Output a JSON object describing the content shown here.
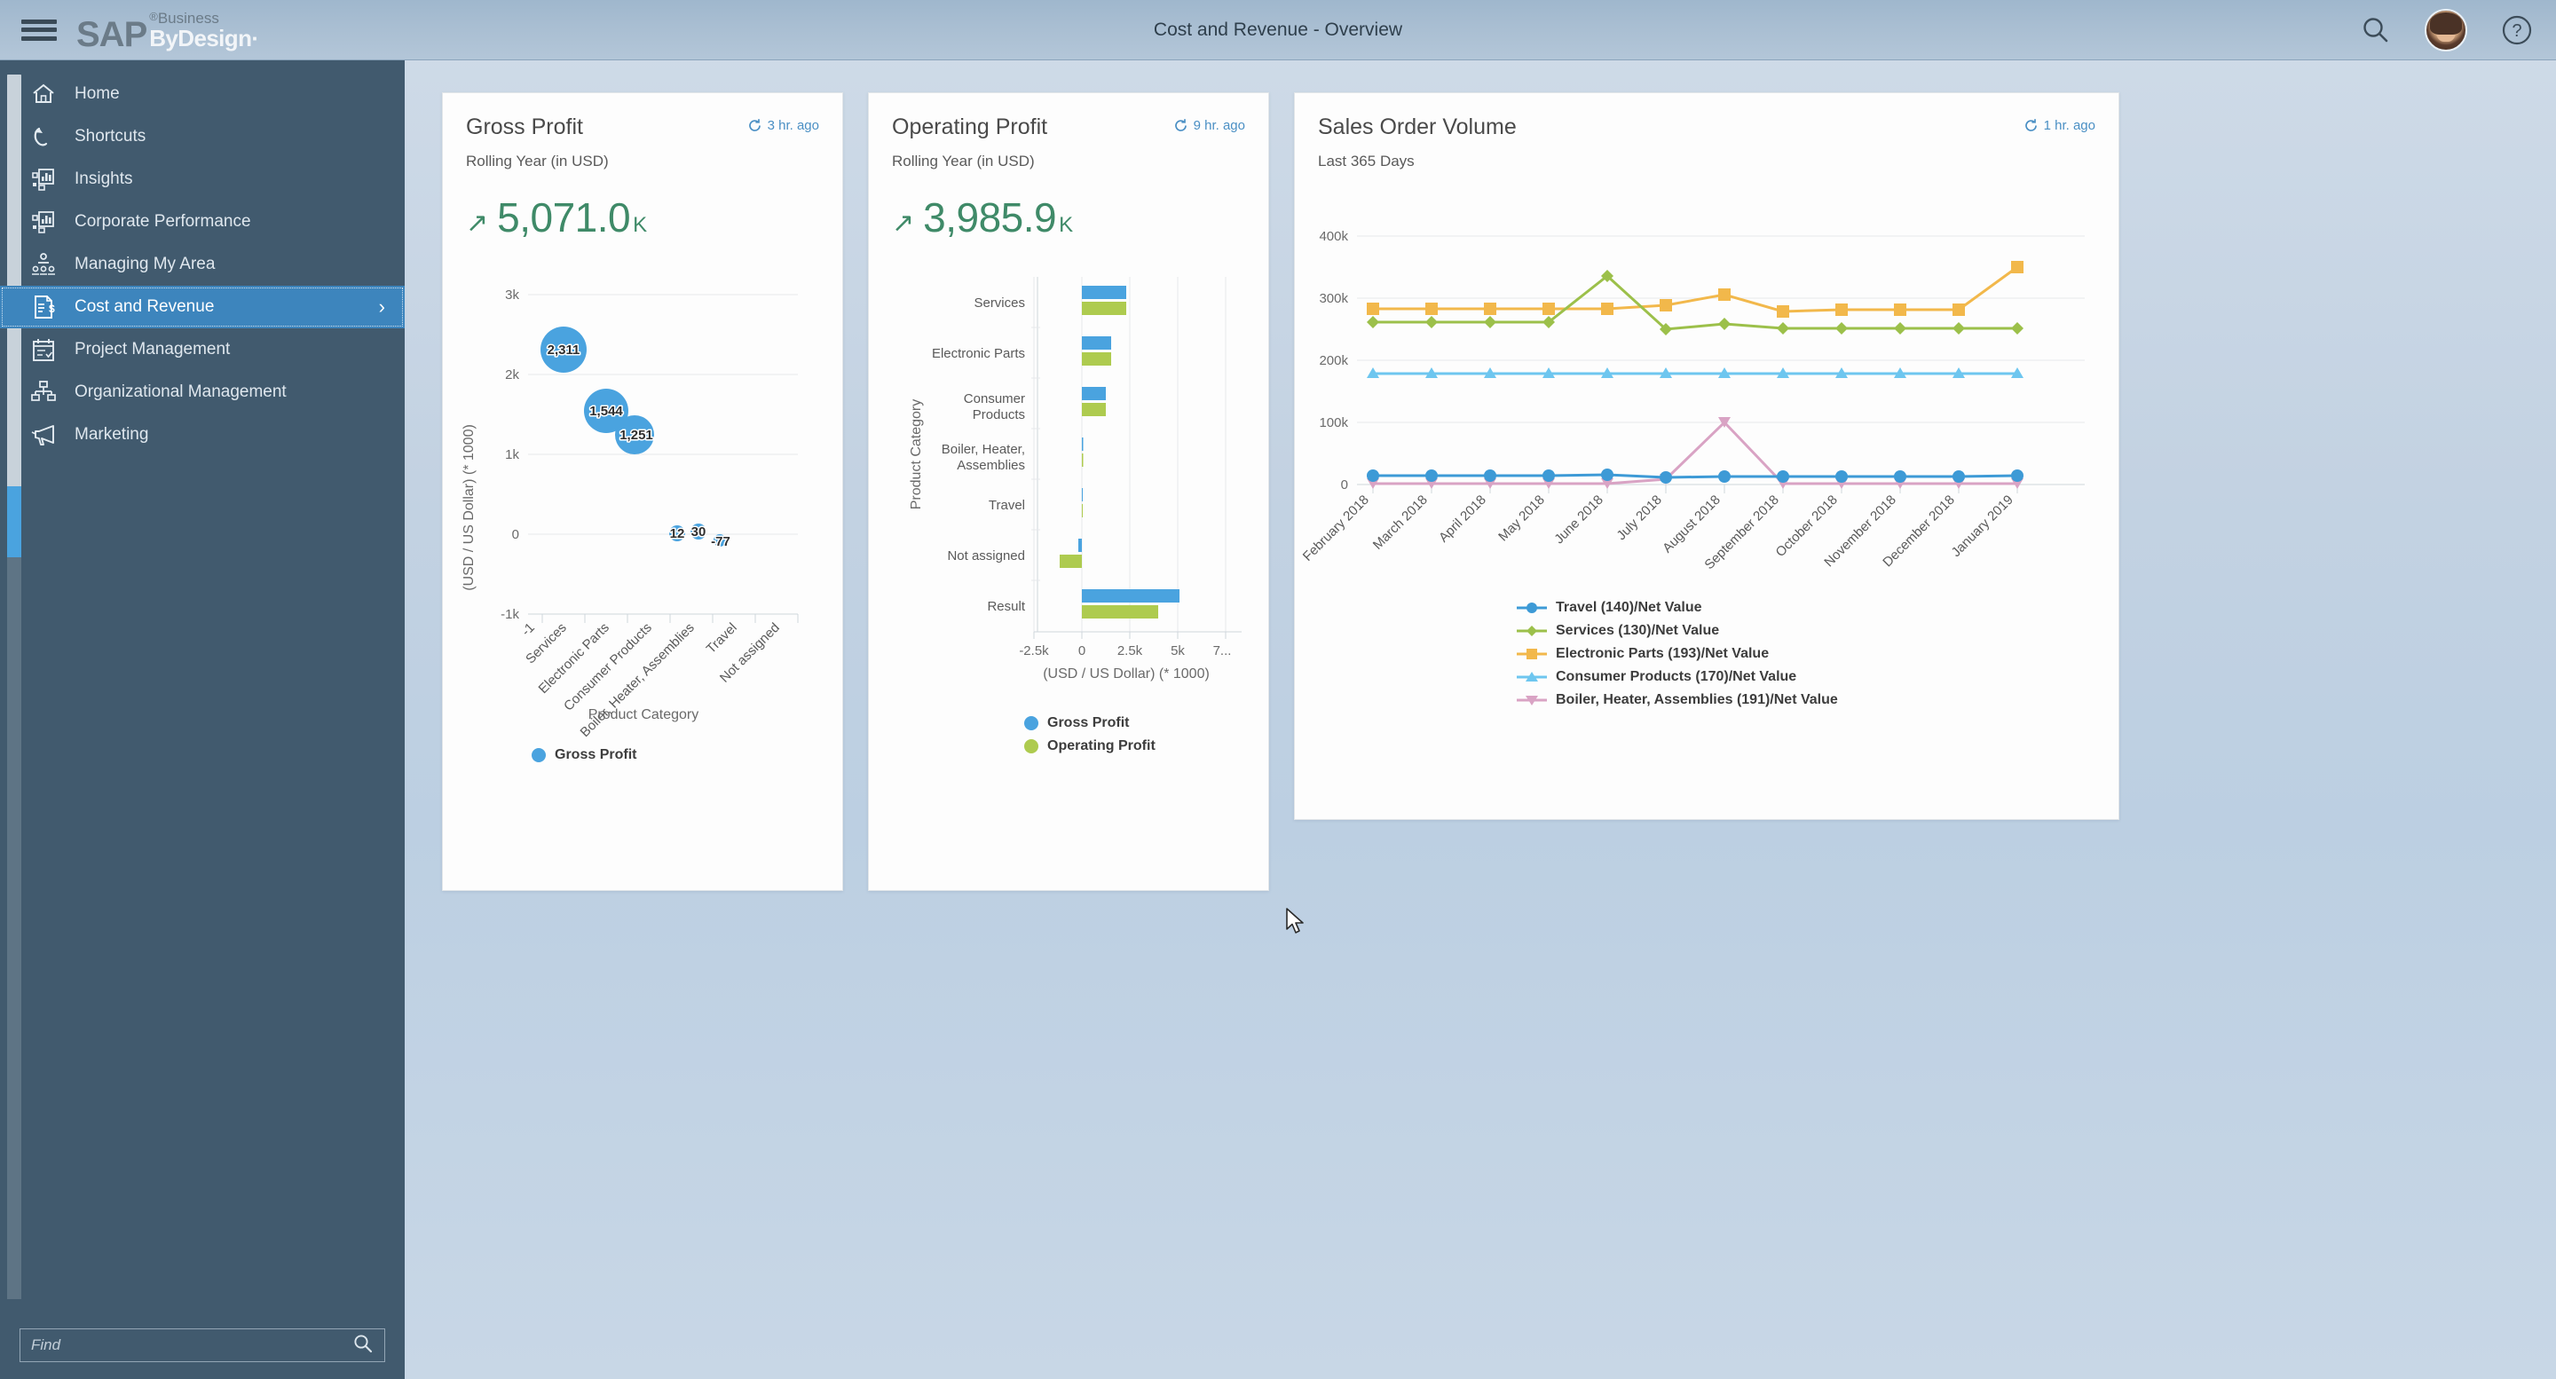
{
  "header": {
    "title": "Cost and Revenue - Overview",
    "brand": {
      "sap": "SAP",
      "reg": "®",
      "business": "Business",
      "bydesign": "ByDesign·"
    },
    "menu_label": "Menu",
    "search_label": "Search",
    "help_label": "Help",
    "avatar_label": "User Profile"
  },
  "sidebar": {
    "find_placeholder": "Find",
    "find_value": "",
    "items": [
      {
        "label": "Home",
        "icon": "home-icon",
        "active": false
      },
      {
        "label": "Shortcuts",
        "icon": "shortcuts-icon",
        "active": false
      },
      {
        "label": "Insights",
        "icon": "insights-icon",
        "active": false
      },
      {
        "label": "Corporate Performance",
        "icon": "corporate-performance-icon",
        "active": false
      },
      {
        "label": "Managing My Area",
        "icon": "managing-my-area-icon",
        "active": false
      },
      {
        "label": "Cost and Revenue",
        "icon": "cost-and-revenue-icon",
        "active": true,
        "chevron": "›"
      },
      {
        "label": "Project Management",
        "icon": "project-management-icon",
        "active": false
      },
      {
        "label": "Organizational Management",
        "icon": "organizational-management-icon",
        "active": false
      },
      {
        "label": "Marketing",
        "icon": "marketing-icon",
        "active": false
      }
    ]
  },
  "cards": {
    "gross_profit": {
      "title": "Gross Profit",
      "subtitle": "Rolling Year (in USD)",
      "refresh": "3 hr. ago",
      "kpi_arrow": "↗",
      "kpi_value": "5,071.0",
      "kpi_unit": "K",
      "legend": [
        {
          "label": "Gross Profit",
          "color": "#4aa3df"
        }
      ]
    },
    "operating_profit": {
      "title": "Operating Profit",
      "subtitle": "Rolling Year (in USD)",
      "refresh": "9 hr. ago",
      "kpi_arrow": "↗",
      "kpi_value": "3,985.9",
      "kpi_unit": "K",
      "legend": [
        {
          "label": "Gross Profit",
          "color": "#4aa3df"
        },
        {
          "label": "Operating Profit",
          "color": "#aecb4f"
        }
      ]
    },
    "sales_order_volume": {
      "title": "Sales Order Volume",
      "subtitle": "Last 365 Days",
      "refresh": "1 hr. ago"
    }
  },
  "chart_data": [
    {
      "type": "scatter",
      "name": "gross-profit-bubble-chart",
      "title": "Gross Profit",
      "xlabel": "Product Category",
      "ylabel": "(USD / US Dollar) (* 1000)",
      "categories": [
        "Services",
        "Electronic Parts",
        "Consumer Products",
        "Boiler, Heater, Assemblies",
        "Travel",
        "Not assigned"
      ],
      "values": [
        2311,
        1544,
        1251,
        12,
        30,
        -77
      ],
      "labels": [
        "2,311",
        "1,544",
        "1,251",
        "12",
        "30",
        "-77"
      ],
      "bubble_sizes": [
        26,
        25,
        22,
        9,
        9,
        7
      ],
      "yticks": [
        "-1k",
        "0",
        "1k",
        "2k",
        "3k"
      ],
      "ytickvals": [
        -1000,
        0,
        1000,
        2000,
        3000
      ],
      "ylim": [
        -1000,
        3000
      ],
      "xtick_extra": "-1",
      "grid": true,
      "legend_position": "bottom",
      "series": [
        {
          "name": "Gross Profit",
          "color": "#4aa3df",
          "values": [
            2311,
            1544,
            1251,
            12,
            30,
            -77
          ]
        }
      ]
    },
    {
      "type": "bar",
      "name": "operating-profit-bar-chart",
      "title": "Operating Profit",
      "orientation": "horizontal",
      "xlabel": "(USD / US Dollar) (* 1000)",
      "ylabel": "Product Category",
      "categories": [
        "Services",
        "Electronic Parts",
        "Consumer Products",
        "Boiler, Heater, Assemblies",
        "Travel",
        "Not assigned",
        "Result"
      ],
      "xticks": [
        "-2.5k",
        "0",
        "2.5k",
        "5k",
        "7..."
      ],
      "xtickvals": [
        -2500,
        0,
        2500,
        5000,
        7500
      ],
      "xlim": [
        -3400,
        8300
      ],
      "grid": true,
      "legend_position": "bottom",
      "series": [
        {
          "name": "Gross Profit",
          "color": "#4aa3df",
          "values": [
            2311,
            1544,
            1251,
            12,
            30,
            77,
            5071
          ]
        },
        {
          "name": "Operating Profit",
          "color": "#aecb4f",
          "values": [
            2300,
            1520,
            1230,
            10,
            0,
            -1150,
            3986
          ]
        }
      ]
    },
    {
      "type": "line",
      "name": "sales-order-volume-line-chart",
      "title": "Sales Order Volume",
      "subtitle": "Last 365 Days",
      "xlabel": "",
      "ylabel": "",
      "categories": [
        "February 2018",
        "March 2018",
        "April 2018",
        "May 2018",
        "June 2018",
        "July 2018",
        "August 2018",
        "September 2018",
        "October 2018",
        "November 2018",
        "December 2018",
        "January 2019"
      ],
      "yticks": [
        "0",
        "100k",
        "200k",
        "300k",
        "400k"
      ],
      "ytickvals": [
        0,
        100000,
        200000,
        300000,
        400000
      ],
      "ylim": [
        0,
        420000
      ],
      "grid": true,
      "legend_position": "bottom",
      "series": [
        {
          "name": "Travel (140)/Net Value",
          "color": "#3d9ad6",
          "marker": "circle",
          "values": [
            14000,
            14000,
            14000,
            14000,
            16000,
            12000,
            13000,
            13000,
            13000,
            13000,
            13000,
            14000
          ]
        },
        {
          "name": "Services (130)/Net Value",
          "color": "#a5c council",
          "marker": "diamond",
          "values": [
            262000,
            262000,
            262000,
            262000,
            335000,
            250000,
            258000,
            252000,
            252000,
            252000,
            252000,
            252000
          ]
        },
        {
          "name": "Electronic Parts (193)/Net Value",
          "color": "#f2b84b",
          "marker": "square",
          "values": [
            283000,
            283000,
            283000,
            283000,
            283000,
            288000,
            306000,
            278000,
            281000,
            281000,
            281000,
            350000
          ]
        },
        {
          "name": "Consumer Products (170)/Net Value",
          "color": "#6ec6ef",
          "marker": "triangle",
          "values": [
            178000,
            178000,
            178000,
            178000,
            178000,
            178000,
            178000,
            178000,
            178000,
            178000,
            178000,
            178000
          ]
        },
        {
          "name": "Boiler, Heater, Assemblies (191)/Net Value",
          "color": "#d9a3c4",
          "marker": "triangle-down",
          "values": [
            2000,
            2000,
            2000,
            2000,
            2000,
            8000,
            100000,
            2000,
            2000,
            2000,
            2000,
            2000
          ]
        }
      ]
    }
  ]
}
